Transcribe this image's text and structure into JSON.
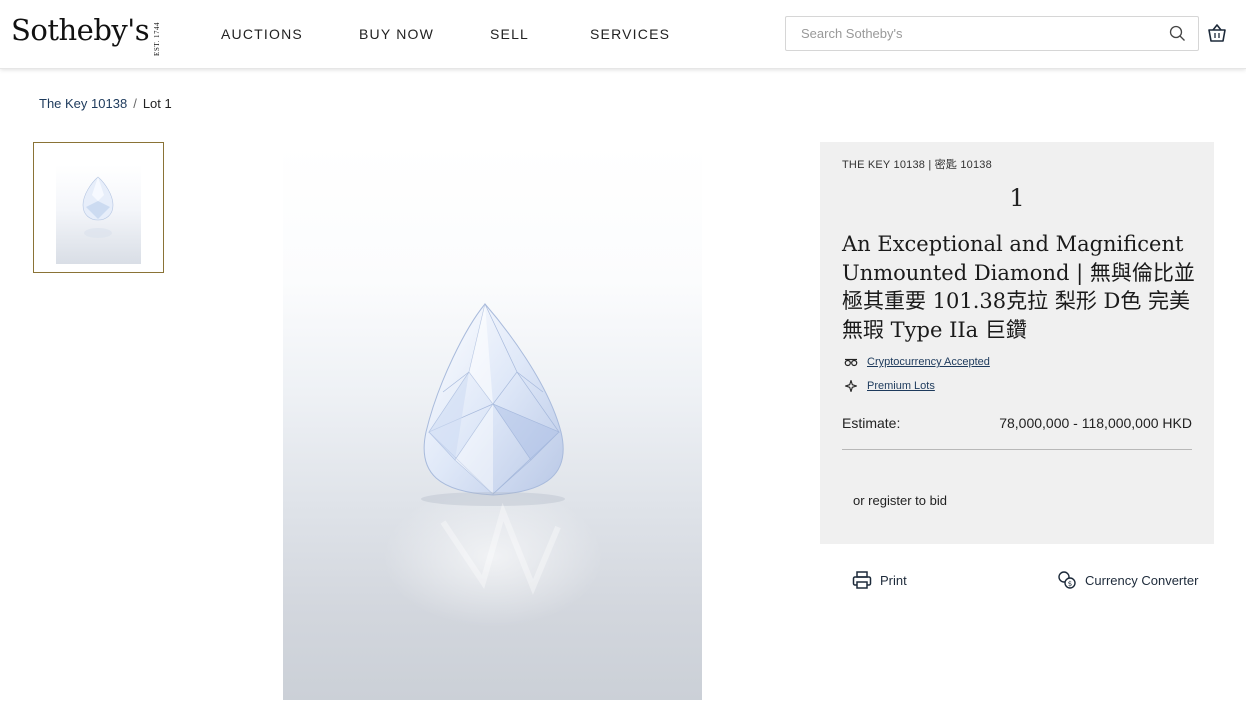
{
  "header": {
    "logo": "Sotheby's",
    "logo_est": "EST. 1744",
    "nav": [
      "AUCTIONS",
      "BUY NOW",
      "SELL",
      "SERVICES"
    ],
    "search_placeholder": "Search Sotheby's"
  },
  "breadcrumb": {
    "auction": "The Key 10138",
    "separator": "/",
    "lot": "Lot 1"
  },
  "lot": {
    "auction_label": "THE KEY 10138 | 密匙 10138",
    "number": "1",
    "title": "An Exceptional and Magnificent Unmounted Diamond | 無與倫比並極其重要 101.38克拉 梨形 D色 完美無瑕 Type IIa 巨鑽",
    "features": [
      {
        "label": "Cryptocurrency Accepted",
        "icon": "crypto-icon"
      },
      {
        "label": "Premium Lots",
        "icon": "sparkle-icon"
      }
    ],
    "estimate_label": "Estimate:",
    "estimate_value": "78,000,000 - 118,000,000 HKD",
    "register_text": "or register to bid"
  },
  "actions": {
    "print": "Print",
    "currency_converter": "Currency Converter"
  },
  "colors": {
    "link": "#1d3a5c",
    "panel_bg": "#f0f0f0",
    "thumb_border": "#8a7336"
  }
}
